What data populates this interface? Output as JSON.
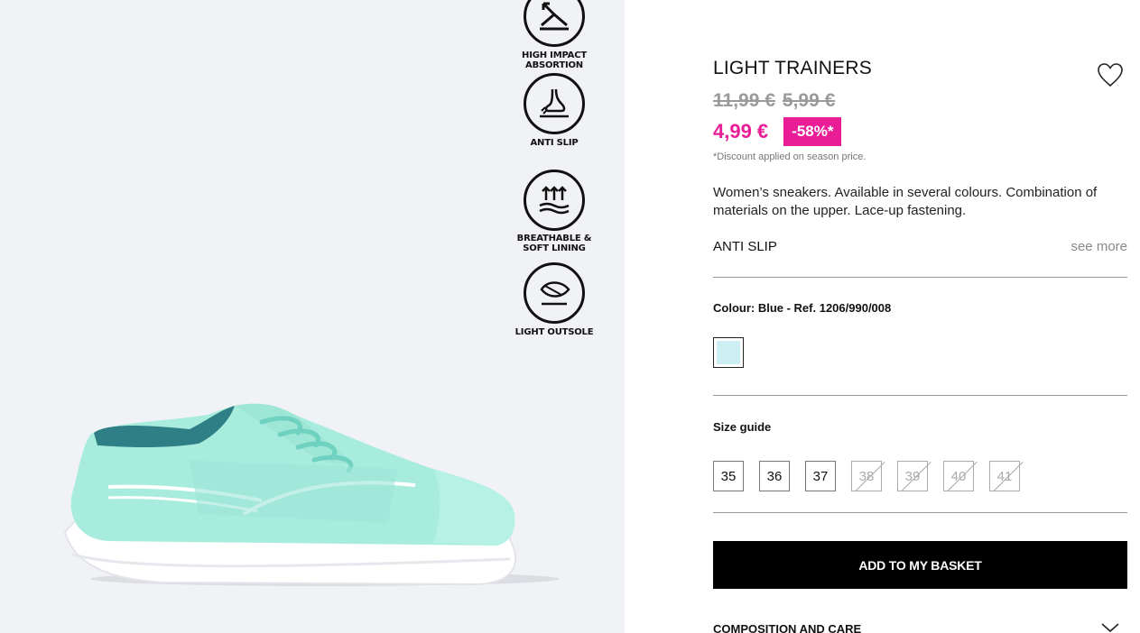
{
  "features": [
    {
      "label": "HIGH IMPACT ABSORTION",
      "icon": "impact-absorption-icon"
    },
    {
      "label": "ANTI SLIP",
      "icon": "anti-slip-foot-icon"
    },
    {
      "label": "BREATHABLE & SOFT LINING",
      "icon": "breathable-arrows-icon"
    },
    {
      "label": "LIGHT OUTSOLE",
      "icon": "feather-icon"
    }
  ],
  "product": {
    "title": "LIGHT TRAINERS",
    "old_price_1": "11,99 €",
    "old_price_2": "5,99 €",
    "current_price": "4,99 €",
    "discount": "-58%*",
    "discount_note": "*Discount applied on season price.",
    "description": "Women’s sneakers. Available in several colours. Combination of materials on the upper. Lace-up fastening.",
    "feature_tag": "ANTI SLIP",
    "see_more": "see more",
    "colour_label": "Colour: Blue - Ref. 1206/990/008",
    "swatch_color": "#cdeff4",
    "size_guide": "Size guide",
    "sizes": [
      {
        "label": "35",
        "available": true
      },
      {
        "label": "36",
        "available": true
      },
      {
        "label": "37",
        "available": true
      },
      {
        "label": "38",
        "available": false
      },
      {
        "label": "39",
        "available": false
      },
      {
        "label": "40",
        "available": false
      },
      {
        "label": "41",
        "available": false
      }
    ],
    "add_to_basket": "ADD TO MY BASKET",
    "composition": "COMPOSITION AND CARE"
  },
  "colors": {
    "accent_pink": "#e91e97",
    "shoe_mint": "#a8ecde",
    "panel_bg": "#f1f2f6"
  }
}
